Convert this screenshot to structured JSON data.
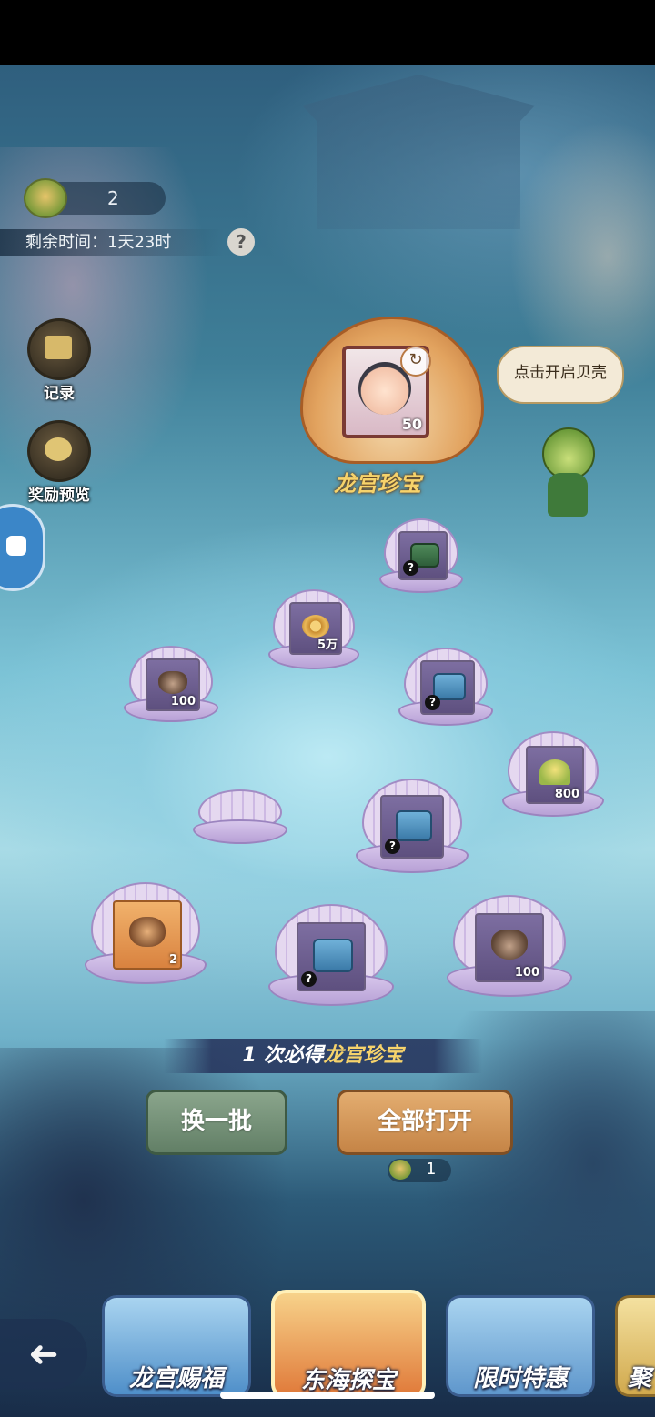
{
  "hud": {
    "shell_currency": "2",
    "time_remaining": "剩余时间：1天23时",
    "help_symbol": "?"
  },
  "side_buttons": {
    "records_label": "记录",
    "reward_preview_label": "奖励预览"
  },
  "featured": {
    "count": "50",
    "label": "龙宫珍宝",
    "swap_symbol": "↻"
  },
  "npc": {
    "speech": "点击开启贝壳"
  },
  "shells": [
    {
      "item": "green-chest",
      "count": "",
      "mystery": true
    },
    {
      "item": "coin",
      "count": "5万",
      "mystery": false
    },
    {
      "item": "pouch",
      "count": "100",
      "mystery": false
    },
    {
      "item": "blue-chest",
      "count": "",
      "mystery": true
    },
    {
      "item": "flower",
      "count": "800",
      "mystery": false
    },
    {
      "item": "closed-shell",
      "count": "",
      "mystery": false
    },
    {
      "item": "blue-chest",
      "count": "",
      "mystery": true
    },
    {
      "item": "mask",
      "count": "2",
      "mystery": false
    },
    {
      "item": "blue-chest",
      "count": "",
      "mystery": true
    },
    {
      "item": "pouch",
      "count": "100",
      "mystery": false
    }
  ],
  "bottom": {
    "banner_count": "1",
    "banner_text": " 次必得",
    "banner_highlight": "龙宫珍宝",
    "swap_button": "换一批",
    "open_all_button": "全部打开",
    "open_cost": "1"
  },
  "tabs": [
    {
      "label": "龙宫赐福"
    },
    {
      "label": "东海探宝"
    },
    {
      "label": "限时特惠"
    },
    {
      "label": "聚"
    }
  ],
  "back_symbol": "➜"
}
